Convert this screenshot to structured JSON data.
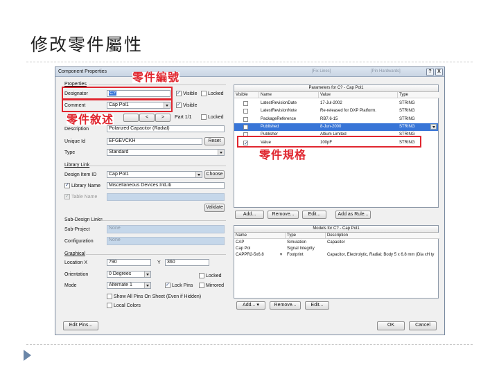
{
  "slide": {
    "title": "修改零件屬性"
  },
  "dialog": {
    "title": "Component Properties",
    "title_faint_1": "[Fix Lines]",
    "title_faint_2": "[Pin Hardwards]",
    "help": "?",
    "close": "X"
  },
  "properties": {
    "section": "Properties",
    "designator_label": "Designator",
    "designator_value": "C?",
    "comment_label": "Comment",
    "comment_value": "Cap Pol1",
    "visible_label": "Visible",
    "locked_label": "Locked",
    "part_label": "Part 1/1",
    "description_label": "Description",
    "description_value": "Polarized Capacitor (Radial)",
    "unique_id_label": "Unique Id",
    "unique_id_value": "EFGEVCKH",
    "reset_button": "Reset",
    "type_label": "Type",
    "type_value": "Standard"
  },
  "library_link": {
    "section": "Library Link",
    "design_item_label": "Design Item ID",
    "design_item_value": "Cap Pol1",
    "choose_button": "Choose",
    "library_name_label": "Library Name",
    "library_name_value": "Miscellaneous Devices.IntLib",
    "table_name_label": "Table Name",
    "validate_button": "Validate"
  },
  "sub_design": {
    "section": "Sub-Design Links",
    "sub_project_label": "Sub-Project",
    "sub_project_value": "None",
    "configuration_label": "Configuration",
    "configuration_value": "None"
  },
  "graphical": {
    "section": "Graphical",
    "location_label": "Location  X",
    "x_value": "790",
    "y_label": "Y",
    "y_value": "360",
    "orientation_label": "Orientation",
    "orientation_value": "0 Degrees",
    "locked_label": "Locked",
    "mode_label": "Mode",
    "mode_value": "Alternate 1",
    "lock_pins_label": "Lock Pins",
    "mirrored_label": "Mirrored",
    "show_all_pins_label": "Show All Pins On Sheet (Even if Hidden)",
    "local_colors_label": "Local Colors"
  },
  "parameters": {
    "header": "Parameters for C? - Cap Pol1",
    "columns": [
      "Visible",
      "Name",
      "Value",
      "Type"
    ],
    "rows": [
      {
        "visible": false,
        "name": "LatestRevisionDate",
        "value": "17-Jul-2002",
        "type": "STRING"
      },
      {
        "visible": false,
        "name": "LatestRevisionNote",
        "value": "Re-released for DXP Platform.",
        "type": "STRING"
      },
      {
        "visible": false,
        "name": "PackageReference",
        "value": "RB7.6-15",
        "type": "STRING"
      },
      {
        "visible": false,
        "name": "Published",
        "value": "8-Jun-2000",
        "type": "STRING"
      },
      {
        "visible": false,
        "name": "Publisher",
        "value": "Altium Limited",
        "type": "STRING"
      },
      {
        "visible": true,
        "name": "Value",
        "value": "100pF",
        "type": "STRING"
      }
    ],
    "add_button": "Add...",
    "remove_button": "Remove...",
    "edit_button": "Edit...",
    "add_rule_button": "Add as Rule..."
  },
  "models": {
    "header": "Models for C? - Cap Pol1",
    "columns": [
      "Name",
      "Type",
      "Description"
    ],
    "rows": [
      {
        "name": "CAP",
        "type": "Simulation",
        "description": "Capacitor"
      },
      {
        "name": "Cap Pol",
        "type": "Signal Integrity",
        "description": ""
      },
      {
        "name": "CAPPR2-5x6.8",
        "type": "Footprint",
        "description": "Capacitor, Electrolytic, Radial; Body 5 x 6.8 mm (Dia xH ty"
      }
    ],
    "add_button": "Add...",
    "remove_button": "Remove...",
    "edit_button": "Edit..."
  },
  "footer": {
    "edit_pins_button": "Edit Pins...",
    "ok_button": "OK",
    "cancel_button": "Cancel"
  },
  "annotations": {
    "designator_note": "零件編號",
    "comment_note": "零件敘述",
    "value_note": "零件規格",
    "color": "#e0262f"
  }
}
